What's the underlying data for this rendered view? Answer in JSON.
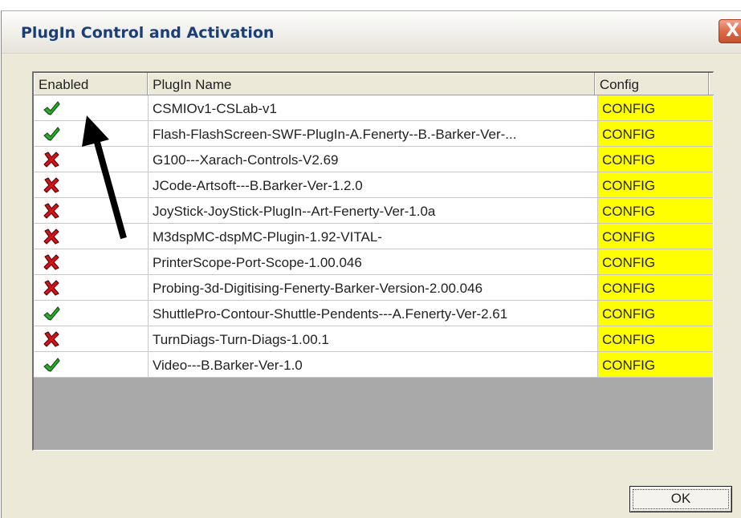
{
  "window": {
    "title": "PlugIn Control and Activation",
    "close_glyph": "X"
  },
  "table": {
    "columns": [
      "Enabled",
      "PlugIn Name",
      "Config"
    ],
    "rows": [
      {
        "enabled": true,
        "name": "CSMIOv1-CSLab-v1",
        "config": "CONFIG"
      },
      {
        "enabled": true,
        "name": "Flash-FlashScreen-SWF-PlugIn-A.Fenerty--B.-Barker-Ver-...",
        "config": "CONFIG"
      },
      {
        "enabled": false,
        "name": "G100---Xarach-Controls-V2.69",
        "config": "CONFIG"
      },
      {
        "enabled": false,
        "name": "JCode-Artsoft---B.Barker-Ver-1.2.0",
        "config": "CONFIG"
      },
      {
        "enabled": false,
        "name": "JoyStick-JoyStick-PlugIn--Art-Fenerty-Ver-1.0a",
        "config": "CONFIG"
      },
      {
        "enabled": false,
        "name": "M3dspMC-dspMC-Plugin-1.92-VITAL-",
        "config": "CONFIG"
      },
      {
        "enabled": false,
        "name": "PrinterScope-Port-Scope-1.00.046",
        "config": "CONFIG"
      },
      {
        "enabled": false,
        "name": "Probing-3d-Digitising-Fenerty-Barker-Version-2.00.046",
        "config": "CONFIG"
      },
      {
        "enabled": true,
        "name": "ShuttlePro-Contour-Shuttle-Pendents---A.Fenerty-Ver-2.61",
        "config": "CONFIG"
      },
      {
        "enabled": false,
        "name": "TurnDiags-Turn-Diags-1.00.1",
        "config": "CONFIG"
      },
      {
        "enabled": true,
        "name": "Video---B.Barker-Ver-1.0",
        "config": "CONFIG"
      }
    ]
  },
  "icons": {
    "enabled_true": "green-check-icon",
    "enabled_false": "red-x-icon"
  },
  "colors": {
    "check": "#2fa82f",
    "cross": "#d4141a",
    "config_bg": "#ffff00",
    "title_text": "#1b3d7a"
  },
  "buttons": {
    "ok_label": "OK"
  }
}
